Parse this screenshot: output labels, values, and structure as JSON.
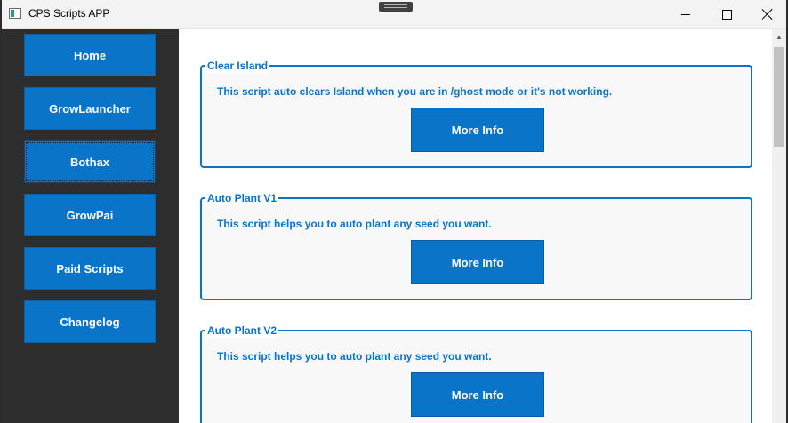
{
  "window": {
    "title": "CPS Scripts APP",
    "icons": {
      "app": "app-icon",
      "minimize": "minimize-icon",
      "maximize": "maximize-icon",
      "close": "close-icon",
      "drag": "drag-handle-icon"
    }
  },
  "sidebar": {
    "items": [
      {
        "label": "Home"
      },
      {
        "label": "GrowLauncher"
      },
      {
        "label": "Bothax"
      },
      {
        "label": "GrowPai"
      },
      {
        "label": "Paid Scripts"
      },
      {
        "label": "Changelog"
      }
    ]
  },
  "scripts": [
    {
      "title": "Clear Island",
      "description": "This script auto clears Island when you are in /ghost mode or it's not working.",
      "button": "More Info"
    },
    {
      "title": "Auto Plant V1",
      "description": "This script helps you to auto plant any seed you want.",
      "button": "More Info"
    },
    {
      "title": "Auto Plant V2",
      "description": "This script helps you to auto plant any seed you want.",
      "button": "More Info"
    }
  ],
  "colors": {
    "accent": "#0a74c9",
    "sidebar_bg": "#2d2d2d",
    "card_bg": "#f8f8f8"
  }
}
